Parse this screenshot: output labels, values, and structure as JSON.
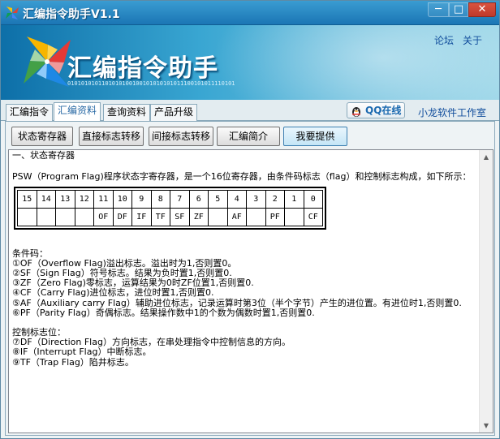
{
  "window": {
    "title": "汇编指令助手V1.1",
    "controls": {
      "minimize": "─",
      "maximize": "□",
      "close": "✕"
    }
  },
  "banner": {
    "title": "汇编指令助手",
    "binary": "0101010101101010100100101010101011100101011110101",
    "links": {
      "forum": "论坛",
      "about": "关于"
    }
  },
  "tabs": [
    {
      "label": "汇编指令",
      "active": false
    },
    {
      "label": "汇编资料",
      "active": true
    },
    {
      "label": "查询资料",
      "active": false
    },
    {
      "label": "产品升级",
      "active": false
    }
  ],
  "qq": {
    "label": "QQ在线"
  },
  "studio": {
    "label": "小龙软件工作室"
  },
  "sub_buttons": [
    {
      "label": "状态寄存器"
    },
    {
      "label": "直接标志转移"
    },
    {
      "label": "间接标志转移"
    },
    {
      "label": "汇编简介"
    },
    {
      "label": "我要提供"
    }
  ],
  "content": {
    "heading": "一、状态寄存器",
    "intro": "PSW（Program Flag)程序状态字寄存器，是一个16位寄存器，由条件码标志（flag）和控制标志构成，如下所示：",
    "bit_numbers": [
      "15",
      "14",
      "13",
      "12",
      "11",
      "10",
      "9",
      "8",
      "7",
      "6",
      "5",
      "4",
      "3",
      "2",
      "1",
      "0"
    ],
    "bit_flags": [
      "",
      "",
      "",
      "",
      "OF",
      "DF",
      "IF",
      "TF",
      "SF",
      "ZF",
      "",
      "AF",
      "",
      "PF",
      "",
      "CF"
    ],
    "condition_heading": "条件码：",
    "condition_lines": [
      "①OF（Overflow Flag)溢出标志。溢出时为1,否则置0。",
      "②SF（Sign Flag）符号标志。结果为负时置1,否则置0.",
      "③ZF（Zero Flag)零标志，运算结果为0时ZF位置1,否则置0.",
      "④CF（Carry Flag)进位标志，进位时置1,否则置0.",
      "⑤AF（Auxiliary carry Flag）辅助进位标志，记录运算时第3位（半个字节）产生的进位置。有进位时1,否则置0.",
      "⑥PF（Parity Flag）奇偶标志。结果操作数中1的个数为偶数时置1,否则置0."
    ],
    "control_heading": "控制标志位：",
    "control_lines": [
      "⑦DF（Direction Flag）方向标志，在串处理指令中控制信息的方向。",
      "⑧IF（Interrupt Flag）中断标志。",
      "⑨TF（Trap Flag）陷井标志。"
    ]
  },
  "scrollbar": {
    "up": "▲",
    "down": "▼"
  }
}
